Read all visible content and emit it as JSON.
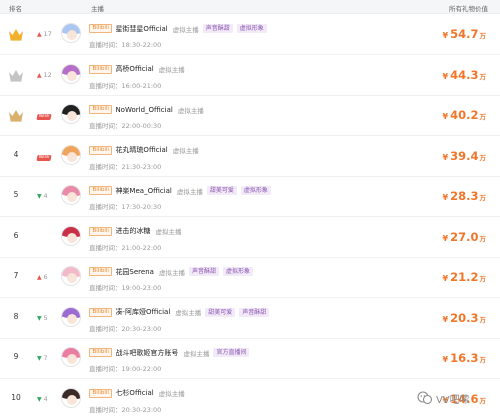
{
  "header": {
    "rank": "排名",
    "anchor": "主播",
    "gift_value": "所有礼物价值"
  },
  "streamer_prefix": "直播时间：",
  "currency": "¥",
  "unit": "万",
  "rows": [
    {
      "rank": "1",
      "medal": "gold",
      "trend_dir": "up",
      "trend_text": "17",
      "platform": "Bilibili",
      "name": "星街彗星Official",
      "category": "虚拟主播",
      "tags": [
        "声音酥甜",
        "虚拟形象"
      ],
      "time": "18:30-22:00",
      "value": "54.7",
      "avatar_hair": "#a9c7f0"
    },
    {
      "rank": "2",
      "medal": "silver",
      "trend_dir": "up",
      "trend_text": "12",
      "platform": "Bilibili",
      "name": "高桥Official",
      "category": "虚拟主播",
      "tags": [],
      "time": "16:00-21:00",
      "value": "44.3",
      "avatar_hair": "#b66fc8"
    },
    {
      "rank": "3",
      "medal": "bronze",
      "trend_dir": "new",
      "trend_text": "NEW",
      "platform": "Bilibili",
      "name": "NoWorld_Official",
      "category": "虚拟主播",
      "tags": [],
      "time": "22:00-00:30",
      "value": "40.2",
      "avatar_hair": "#222222"
    },
    {
      "rank": "4",
      "medal": "",
      "trend_dir": "new",
      "trend_text": "NEW",
      "platform": "Bilibili",
      "name": "花丸晴琉Official",
      "category": "虚拟主播",
      "tags": [],
      "time": "21:30-23:00",
      "value": "39.4",
      "avatar_hair": "#f0a35a"
    },
    {
      "rank": "5",
      "medal": "",
      "trend_dir": "down",
      "trend_text": "4",
      "platform": "Bilibili",
      "name": "神楽Mea_Official",
      "category": "虚拟主播",
      "tags": [
        "甜美可爱",
        "虚拟形象"
      ],
      "time": "17:30-20:30",
      "value": "28.3",
      "avatar_hair": "#e88aa8"
    },
    {
      "rank": "6",
      "medal": "",
      "trend_dir": "none",
      "trend_text": "",
      "platform": "Bilibili",
      "name": "进击的冰糖",
      "category": "虚拟主播",
      "tags": [],
      "time": "21:00-22:00",
      "value": "27.0",
      "avatar_hair": "#c8304a"
    },
    {
      "rank": "7",
      "medal": "",
      "trend_dir": "up",
      "trend_text": "6",
      "platform": "Bilibili",
      "name": "花园Serena",
      "category": "虚拟主播",
      "tags": [
        "声音酥甜",
        "虚拟形象"
      ],
      "time": "19:00-23:00",
      "value": "21.2",
      "avatar_hair": "#f2b9c9"
    },
    {
      "rank": "8",
      "medal": "",
      "trend_dir": "down",
      "trend_text": "5",
      "platform": "Bilibili",
      "name": "凑-阿库娅Official",
      "category": "虚拟主播",
      "tags": [
        "甜美可爱",
        "声音酥甜"
      ],
      "time": "20:30-23:00",
      "value": "20.3",
      "avatar_hair": "#9a6bd2"
    },
    {
      "rank": "9",
      "medal": "",
      "trend_dir": "down",
      "trend_text": "7",
      "platform": "Bilibili",
      "name": "战斗吧歌姬官方账号",
      "category": "虚拟主播",
      "tags": [
        "官方直播间"
      ],
      "time": "19:00-22:00",
      "value": "16.3",
      "avatar_hair": "#e97ea0"
    },
    {
      "rank": "10",
      "medal": "",
      "trend_dir": "down",
      "trend_text": "4",
      "platform": "Bilibili",
      "name": "七杉Official",
      "category": "虚拟主播",
      "tags": [],
      "time": "20:30-23:00",
      "value": "14.6",
      "avatar_hair": "#3a2a28"
    }
  ],
  "colors": {
    "gold": "#f1b12d",
    "silver": "#c4c4c4",
    "bronze": "#d9b16e",
    "accent": "#f0762a"
  },
  "watermark": {
    "text": "VV吧嗦"
  }
}
